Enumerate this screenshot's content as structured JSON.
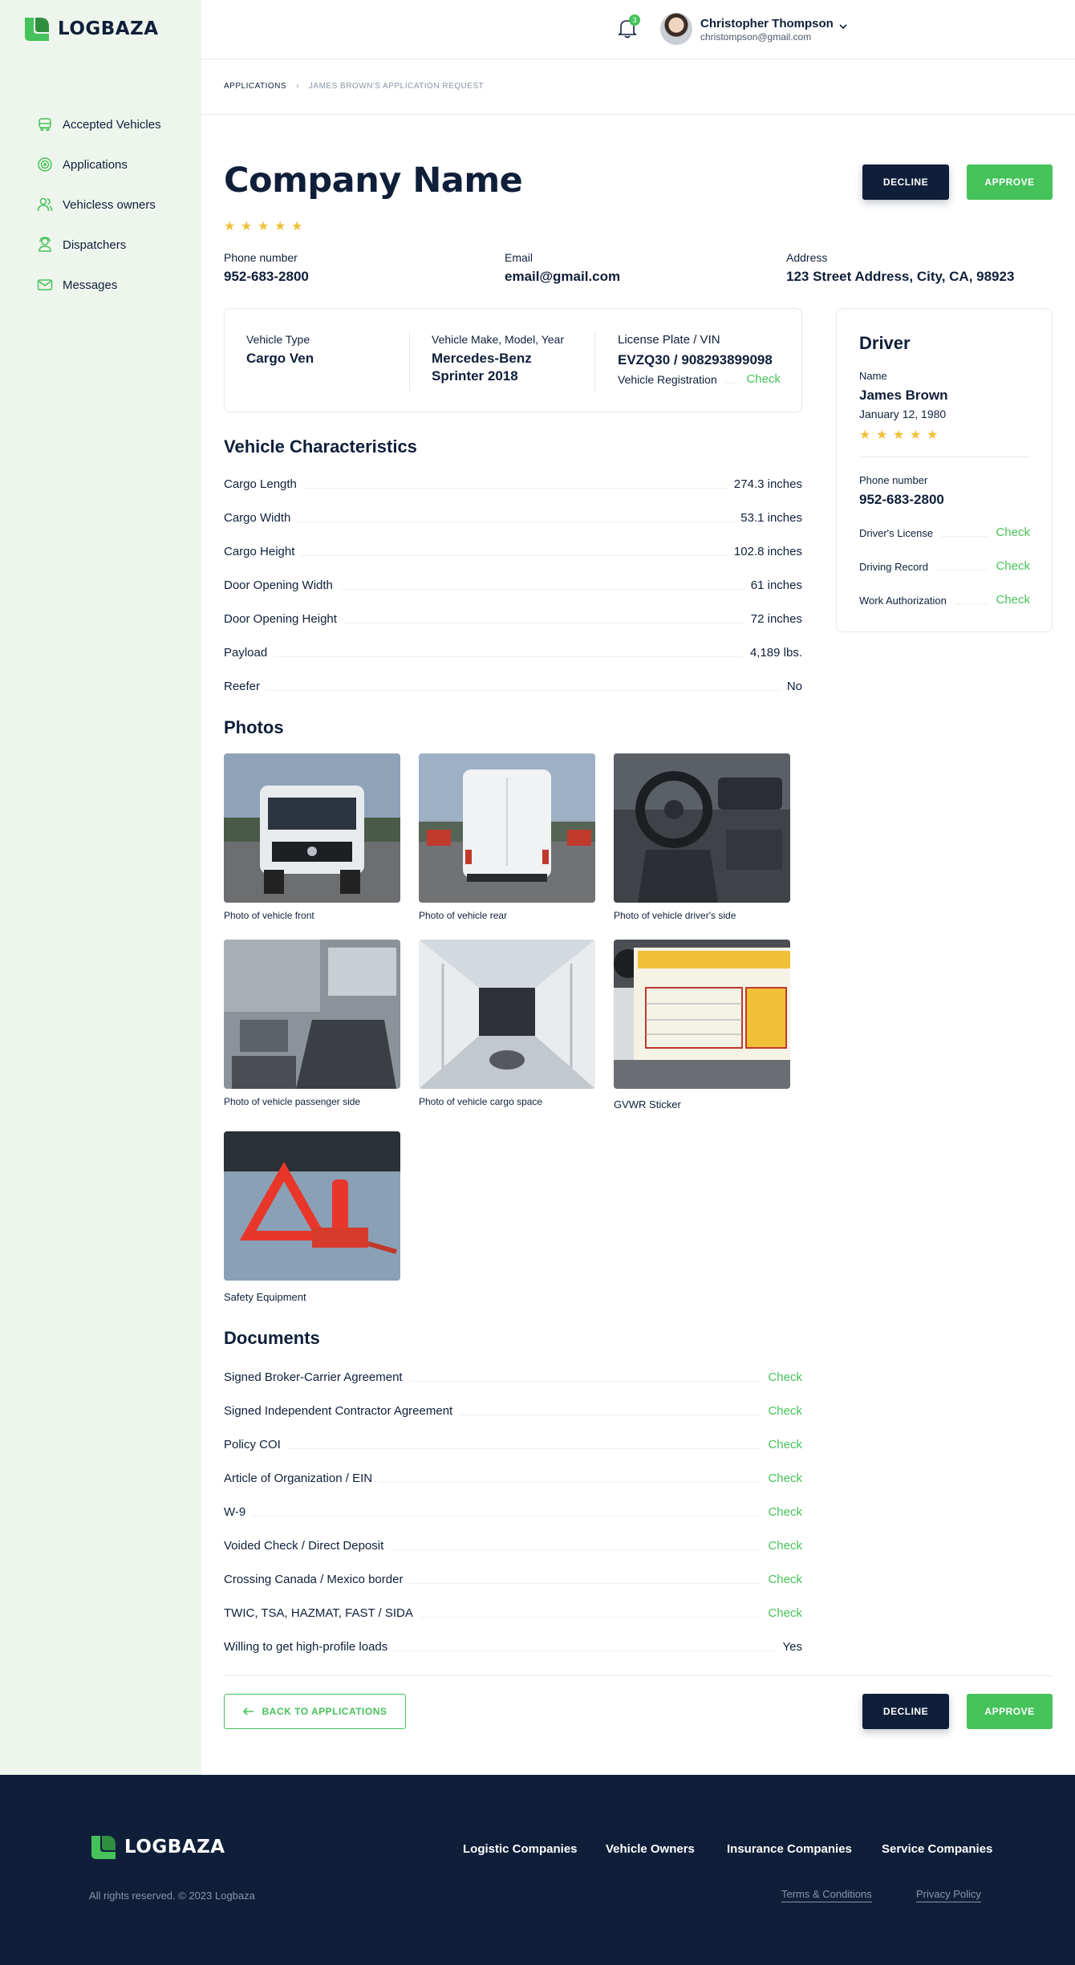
{
  "brand": {
    "name": "LOGBAZA"
  },
  "sidebar": {
    "items": [
      {
        "label": "Accepted Vehicles",
        "icon": "truck-icon"
      },
      {
        "label": "Applications",
        "icon": "target-icon"
      },
      {
        "label": "Vehicless owners",
        "icon": "users-icon"
      },
      {
        "label": "Dispatchers",
        "icon": "headset-icon"
      },
      {
        "label": "Messages",
        "icon": "mail-icon"
      }
    ]
  },
  "topbar": {
    "notifications_count": "3",
    "user_name": "Christopher Thompson",
    "user_email": "christompson@gmail.com"
  },
  "breadcrumb": {
    "root": "APPLICATIONS",
    "separator": "›",
    "current": "JAMES BROWN'S APPLICATION REQUEST"
  },
  "header": {
    "company_name": "Company Name",
    "rating": 5,
    "decline_label": "DECLINE",
    "approve_label": "APPROVE"
  },
  "contact": {
    "phone_label": "Phone number",
    "phone": "952-683-2800",
    "email_label": "Email",
    "email": "email@gmail.com",
    "address_label": "Address",
    "address": "123 Street Address, City, CA, 98923"
  },
  "vehicle": {
    "type_label": "Vehicle Type",
    "type": "Cargo Ven",
    "make_label": "Vehicle Make, Model, Year",
    "make_line1": "Mercedes-Benz",
    "make_line2": "Sprinter 2018",
    "plate_label": "License Plate / VIN",
    "plate": "EVZQ30 / 908293899098",
    "registration_label": "Vehicle Registration",
    "registration_action": "Check"
  },
  "driver": {
    "title": "Driver",
    "name_label": "Name",
    "name": "James Brown",
    "dob": "January 12, 1980",
    "rating": 5,
    "phone_label": "Phone number",
    "phone": "952-683-2800",
    "docs": [
      {
        "label": "Driver's License",
        "action": "Check"
      },
      {
        "label": "Driving Record",
        "action": "Check"
      },
      {
        "label": "Work Authorization",
        "action": "Check"
      }
    ]
  },
  "characteristics": {
    "title": "Vehicle Characteristics",
    "rows": [
      {
        "label": "Cargo Length",
        "value": "274.3 inches"
      },
      {
        "label": "Cargo Width",
        "value": "53.1 inches"
      },
      {
        "label": "Cargo Height",
        "value": "102.8 inches"
      },
      {
        "label": "Door Opening Width",
        "value": "61 inches"
      },
      {
        "label": "Door Opening Height",
        "value": "72 inches"
      },
      {
        "label": "Payload",
        "value": "4,189 lbs."
      },
      {
        "label": "Reefer",
        "value": "No"
      }
    ]
  },
  "photos": {
    "title": "Photos",
    "items": [
      {
        "caption": "Photo of vehicle front"
      },
      {
        "caption": "Photo of vehicle rear"
      },
      {
        "caption": "Photo of vehicle driver's side"
      },
      {
        "caption": "Photo of vehicle passenger side"
      },
      {
        "caption": "Photo of vehicle cargo space"
      },
      {
        "caption": "GVWR Sticker"
      },
      {
        "caption": "Safety Equipment"
      }
    ]
  },
  "documents": {
    "title": "Documents",
    "rows": [
      {
        "label": "Signed Broker-Carrier Agreement",
        "value": "Check"
      },
      {
        "label": "Signed Independent Contractor Agreement",
        "value": "Check"
      },
      {
        "label": "Policy COI",
        "value": "Check"
      },
      {
        "label": "Article of Organization / EIN",
        "value": "Check"
      },
      {
        "label": "W-9",
        "value": "Check"
      },
      {
        "label": "Voided Check / Direct Deposit",
        "value": "Check"
      },
      {
        "label": "Crossing Canada / Mexico border",
        "value": "Check"
      },
      {
        "label": "TWIC, TSA, HAZMAT, FAST / SIDA",
        "value": "Check"
      },
      {
        "label": "Willing to get high-profile loads",
        "value": "Yes"
      }
    ]
  },
  "bottom_actions": {
    "back_label": "BACK TO APPLICATIONS",
    "decline_label": "DECLINE",
    "approve_label": "APPROVE"
  },
  "footer": {
    "links": [
      "Logistic Companies",
      "Vehicle Owners",
      "Insurance Companies",
      "Service Companies"
    ],
    "copyright": "All rights reserved. © 2023 Logbaza",
    "terms": "Terms & Conditions",
    "privacy": "Privacy Policy"
  },
  "colors": {
    "accent": "#46c25a",
    "navy": "#0f1f3a",
    "sidebar_bg": "#eef5ec",
    "star": "#f2c037"
  }
}
